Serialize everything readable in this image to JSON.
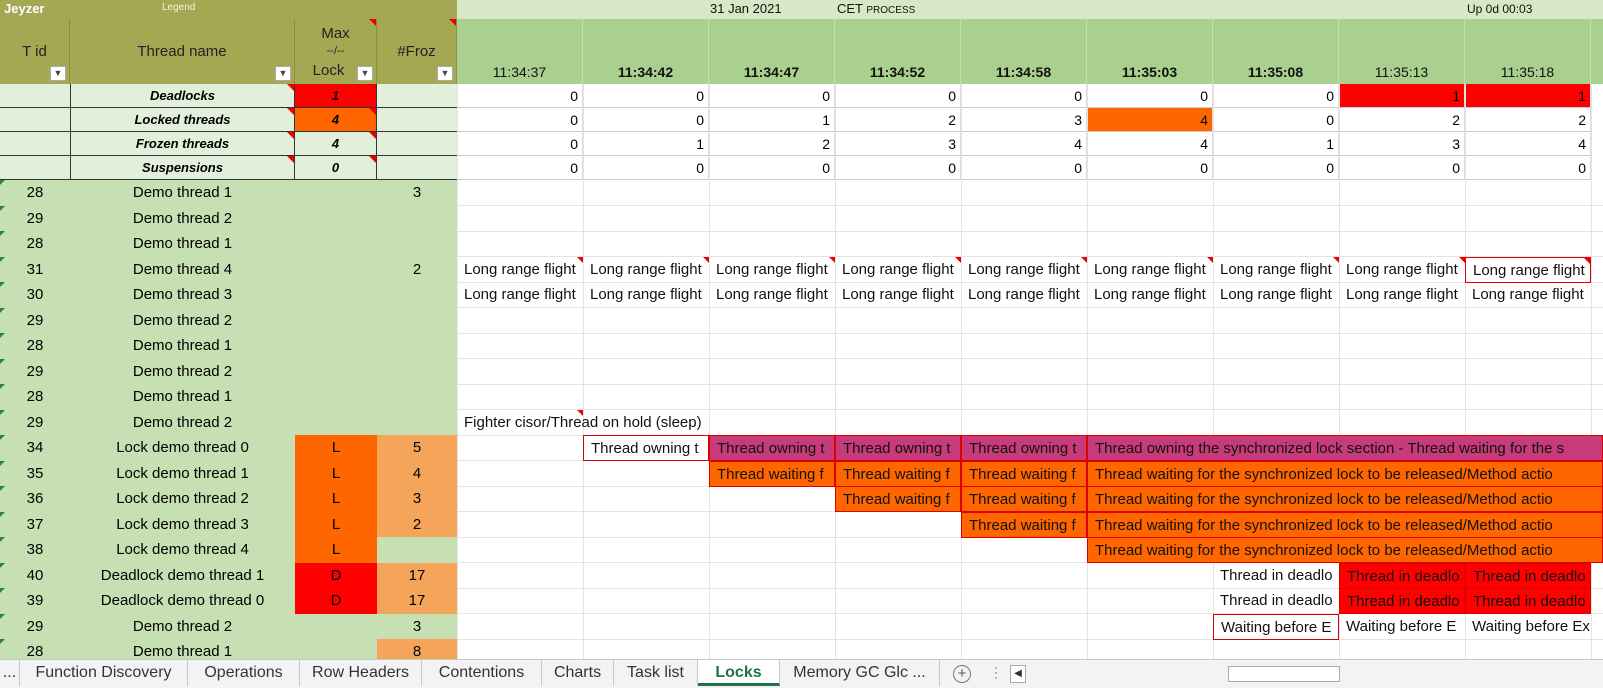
{
  "topbar": {
    "brand": "Jeyzer",
    "legend": "Legend",
    "date": "31 Jan 2021",
    "tz": "CET",
    "process": "PROCESS",
    "uptime": "Up 0d 00:03"
  },
  "headers": {
    "tid": "T id",
    "thread_name": "Thread name",
    "max_top": "Max",
    "max_mid": "--/--",
    "max_bottom": "Lock",
    "froz": "#Froz"
  },
  "timestamps": [
    "11:34:37",
    "11:34:42",
    "11:34:47",
    "11:34:52",
    "11:34:58",
    "11:35:03",
    "11:35:08",
    "11:35:13",
    "11:35:18"
  ],
  "summary": [
    {
      "name": "Deadlocks",
      "value": "1",
      "color": "#ff0000",
      "cells": [
        "0",
        "0",
        "0",
        "0",
        "0",
        "0",
        "0",
        "1",
        "1"
      ]
    },
    {
      "name": "Locked threads",
      "value": "4",
      "color": "#ff6600",
      "cells": [
        "0",
        "0",
        "1",
        "2",
        "3",
        "4",
        "0",
        "2",
        "2"
      ]
    },
    {
      "name": "Frozen threads",
      "value": "4",
      "color": "",
      "cells": [
        "0",
        "1",
        "2",
        "3",
        "4",
        "4",
        "1",
        "3",
        "4"
      ]
    },
    {
      "name": "Suspensions",
      "value": "0",
      "color": "",
      "cells": [
        "0",
        "0",
        "0",
        "0",
        "0",
        "0",
        "0",
        "0",
        "0"
      ]
    }
  ],
  "threads": [
    {
      "tid": "28",
      "name": "Demo thread 1",
      "lock": "",
      "froz": "3"
    },
    {
      "tid": "29",
      "name": "Demo thread 2",
      "lock": "",
      "froz": ""
    },
    {
      "tid": "28",
      "name": "Demo thread 1",
      "lock": "",
      "froz": ""
    },
    {
      "tid": "31",
      "name": "Demo thread 4",
      "lock": "",
      "froz": "2"
    },
    {
      "tid": "30",
      "name": "Demo thread 3",
      "lock": "",
      "froz": ""
    },
    {
      "tid": "29",
      "name": "Demo thread 2",
      "lock": "",
      "froz": ""
    },
    {
      "tid": "28",
      "name": "Demo thread 1",
      "lock": "",
      "froz": ""
    },
    {
      "tid": "29",
      "name": "Demo thread 2",
      "lock": "",
      "froz": ""
    },
    {
      "tid": "28",
      "name": "Demo thread 1",
      "lock": "",
      "froz": ""
    },
    {
      "tid": "29",
      "name": "Demo thread 2",
      "lock": "",
      "froz": ""
    },
    {
      "tid": "34",
      "name": "Lock demo thread 0",
      "lock": "L",
      "froz": "5"
    },
    {
      "tid": "35",
      "name": "Lock demo thread 1",
      "lock": "L",
      "froz": "4"
    },
    {
      "tid": "36",
      "name": "Lock demo thread 2",
      "lock": "L",
      "froz": "3"
    },
    {
      "tid": "37",
      "name": "Lock demo thread 3",
      "lock": "L",
      "froz": "2"
    },
    {
      "tid": "38",
      "name": "Lock demo thread 4",
      "lock": "L",
      "froz": ""
    },
    {
      "tid": "40",
      "name": "Deadlock demo thread 1",
      "lock": "D",
      "froz": "17"
    },
    {
      "tid": "39",
      "name": "Deadlock demo thread 0",
      "lock": "D",
      "froz": "17"
    },
    {
      "tid": "29",
      "name": "Demo thread 2",
      "lock": "",
      "froz": "3"
    },
    {
      "tid": "28",
      "name": "Demo thread 1",
      "lock": "",
      "froz": "8"
    }
  ],
  "texts": {
    "long_range": "Long range flight",
    "fighter": "Fighter cisor/Thread on hold (sleep)",
    "owning": "Thread owning t",
    "owning_full": "Thread owning the synchronized lock section - Thread waiting for the s",
    "waiting": "Thread waiting f",
    "waiting_full": "Thread waiting for the synchronized lock to be released/Method actio",
    "deadlock": "Thread in deadlo",
    "waiting_before": "Waiting before E",
    "waiting_before_last": "Waiting before Ex"
  },
  "tabs": [
    "...",
    "Function Discovery",
    "Operations",
    "Row Headers",
    "Contentions",
    "Charts",
    "Task list",
    "Locks",
    "Memory GC Glc ..."
  ],
  "active_tab": "Locks",
  "colors": {
    "header_olive": "#a4a852",
    "header_green": "#a9d08e",
    "row_green": "#c6e0b4",
    "lock_orange": "#ff6600",
    "deadlock_red": "#ff0000",
    "owning_magenta": "#c73b7a",
    "froz_orange": "#f4a55a"
  }
}
